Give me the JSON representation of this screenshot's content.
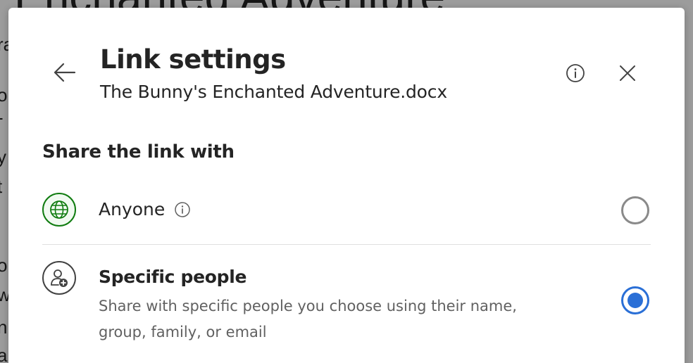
{
  "background": {
    "title": "Enchanted Adventure",
    "fragments": [
      "ra",
      "o",
      "-",
      "y",
      "t",
      "o",
      "w",
      "ni",
      "a"
    ]
  },
  "dialog": {
    "title": "Link settings",
    "filename": "The Bunny's Enchanted Adventure.docx",
    "section_heading": "Share the link with",
    "options": [
      {
        "label": "Anyone",
        "icon": "globe-icon",
        "selected": false
      },
      {
        "label": "Specific people",
        "description": "Share with specific people you choose using their name, group, family, or email",
        "icon": "person-add-icon",
        "selected": true
      }
    ]
  },
  "colors": {
    "accent": "#2a6fd6",
    "globe_green": "#107c10",
    "text_primary": "#242424",
    "text_secondary": "#616161"
  }
}
